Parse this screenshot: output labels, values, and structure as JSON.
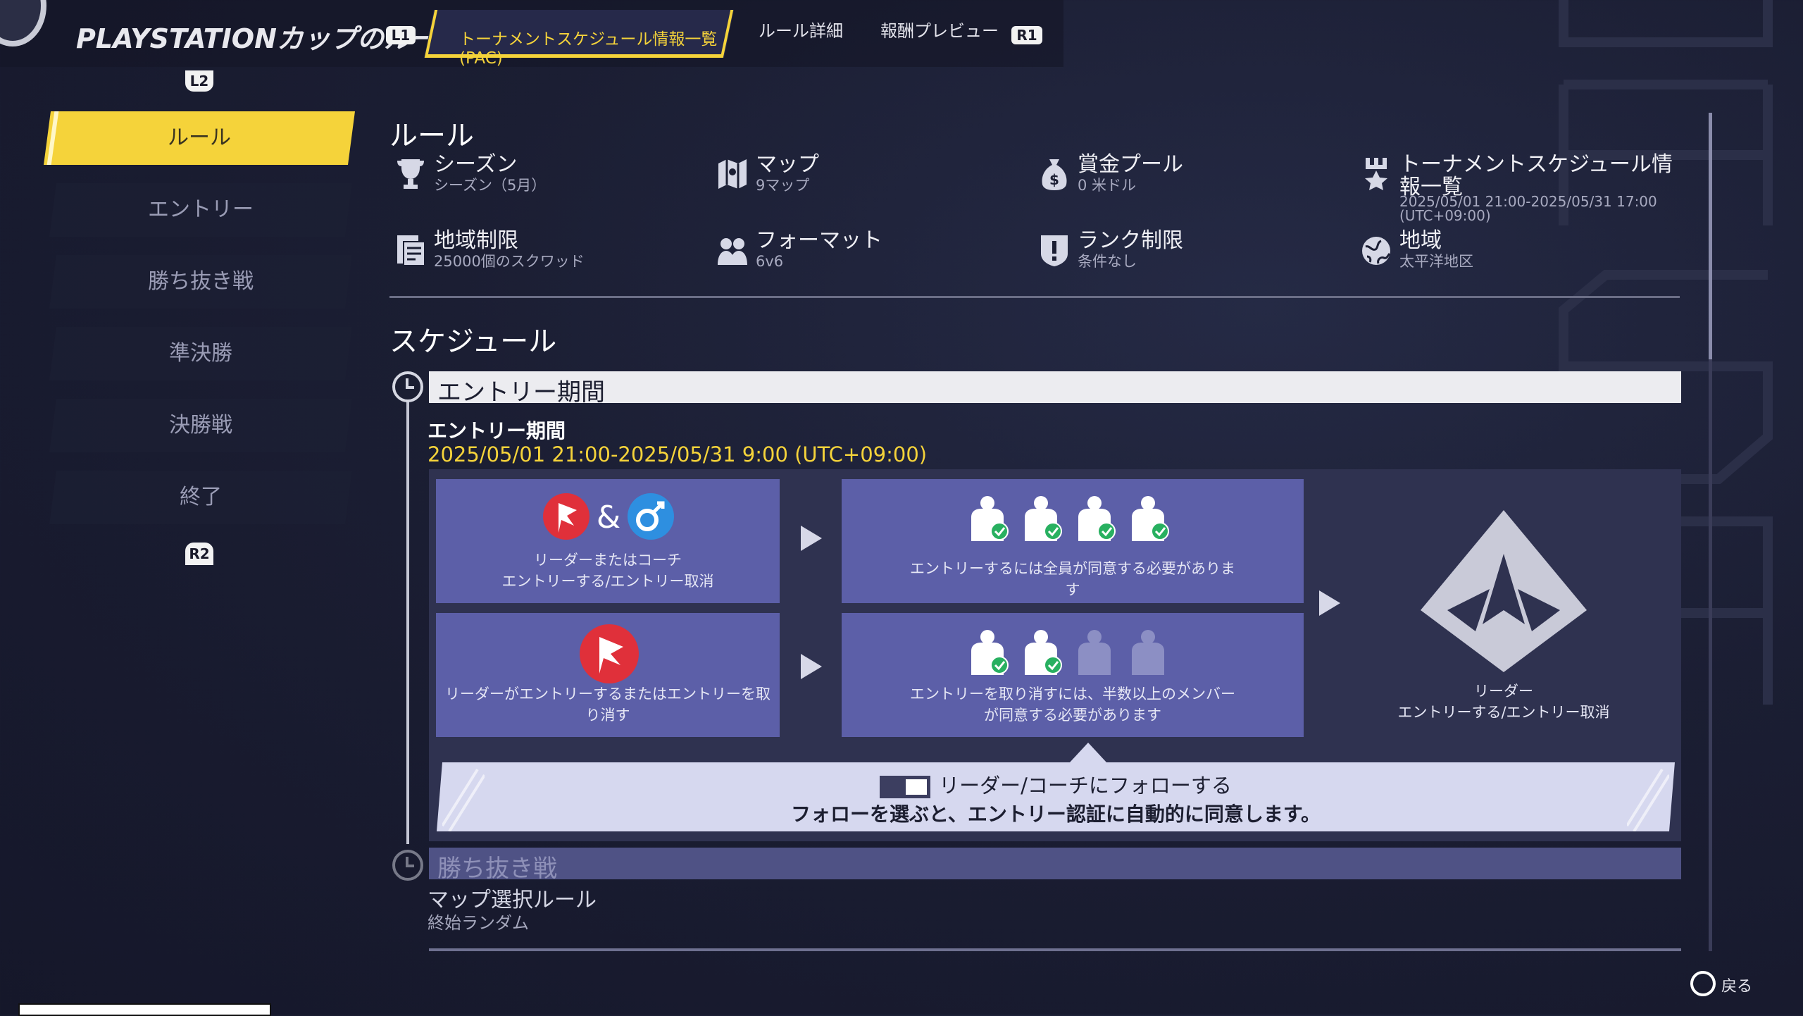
{
  "header": {
    "title": "PLAYSTATIONカップのルール",
    "l1": "L1",
    "r1": "R1",
    "l2": "L2",
    "r2": "R2",
    "tabs": [
      {
        "label": "トーナメントスケジュール情報一覧 (PAC)",
        "active": true
      },
      {
        "label": "ルール詳細",
        "active": false
      },
      {
        "label": "報酬プレビュー",
        "active": false
      }
    ]
  },
  "sidebar": {
    "items": [
      {
        "label": "ルール",
        "active": true
      },
      {
        "label": "エントリー",
        "active": false
      },
      {
        "label": "勝ち抜き戦",
        "active": false
      },
      {
        "label": "準決勝",
        "active": false
      },
      {
        "label": "決勝戦",
        "active": false
      },
      {
        "label": "終了",
        "active": false
      }
    ]
  },
  "rules": {
    "heading": "ルール",
    "items": [
      {
        "label": "シーズン",
        "value": "シーズン（5月）",
        "icon": "trophy-icon"
      },
      {
        "label": "マップ",
        "value": "9マップ",
        "icon": "map-icon"
      },
      {
        "label": "賞金プール",
        "value": "0 米ドル",
        "icon": "prize-bag-icon"
      },
      {
        "label": "トーナメントスケジュール情報一覧",
        "value": "2025/05/01 21:00-2025/05/31 17:00 (UTC+09:00)",
        "icon": "star-tower-icon"
      },
      {
        "label": "地域制限",
        "value": "25000個のスクワッド",
        "icon": "document-icon"
      },
      {
        "label": "フォーマット",
        "value": "6v6",
        "icon": "players-icon"
      },
      {
        "label": "ランク制限",
        "value": "条件なし",
        "icon": "rank-shield-icon"
      },
      {
        "label": "地域",
        "value": "太平洋地区",
        "icon": "globe-icon"
      }
    ]
  },
  "schedule": {
    "heading": "スケジュール",
    "entry_bar": "エントリー期間",
    "entry_title": "エントリー期間",
    "entry_date": "2025/05/01 21:00-2025/05/31 9:00 (UTC+09:00)",
    "box1_line1": "リーダーまたはコーチ",
    "box1_line2": "エントリーする/エントリー取消",
    "box2_text": "エントリーするには全員が同意する必要があります",
    "box3_text": "リーダーがエントリーするまたはエントリーを取り消す",
    "box4_text": "エントリーを取り消すには、半数以上のメンバーが同意する必要があります",
    "leader_line1": "リーダー",
    "leader_line2": "エントリーする/エントリー取消",
    "amp": "&",
    "notice_line1": "リーダー/コーチにフォローする",
    "notice_line2": "フォローを選ぶと、エントリー認証に自動的に同意します。",
    "knockout_bar": "勝ち抜き戦",
    "map_rule_label": "マップ選択ルール",
    "map_rule_value": "終始ランダム"
  },
  "footer": {
    "back_label": "戻る"
  },
  "colors": {
    "accent": "#f5d33a",
    "box": "#5c5fa8",
    "flag_red": "#e0303a",
    "coach_blue": "#2e8fe0",
    "check_green": "#28b060"
  }
}
